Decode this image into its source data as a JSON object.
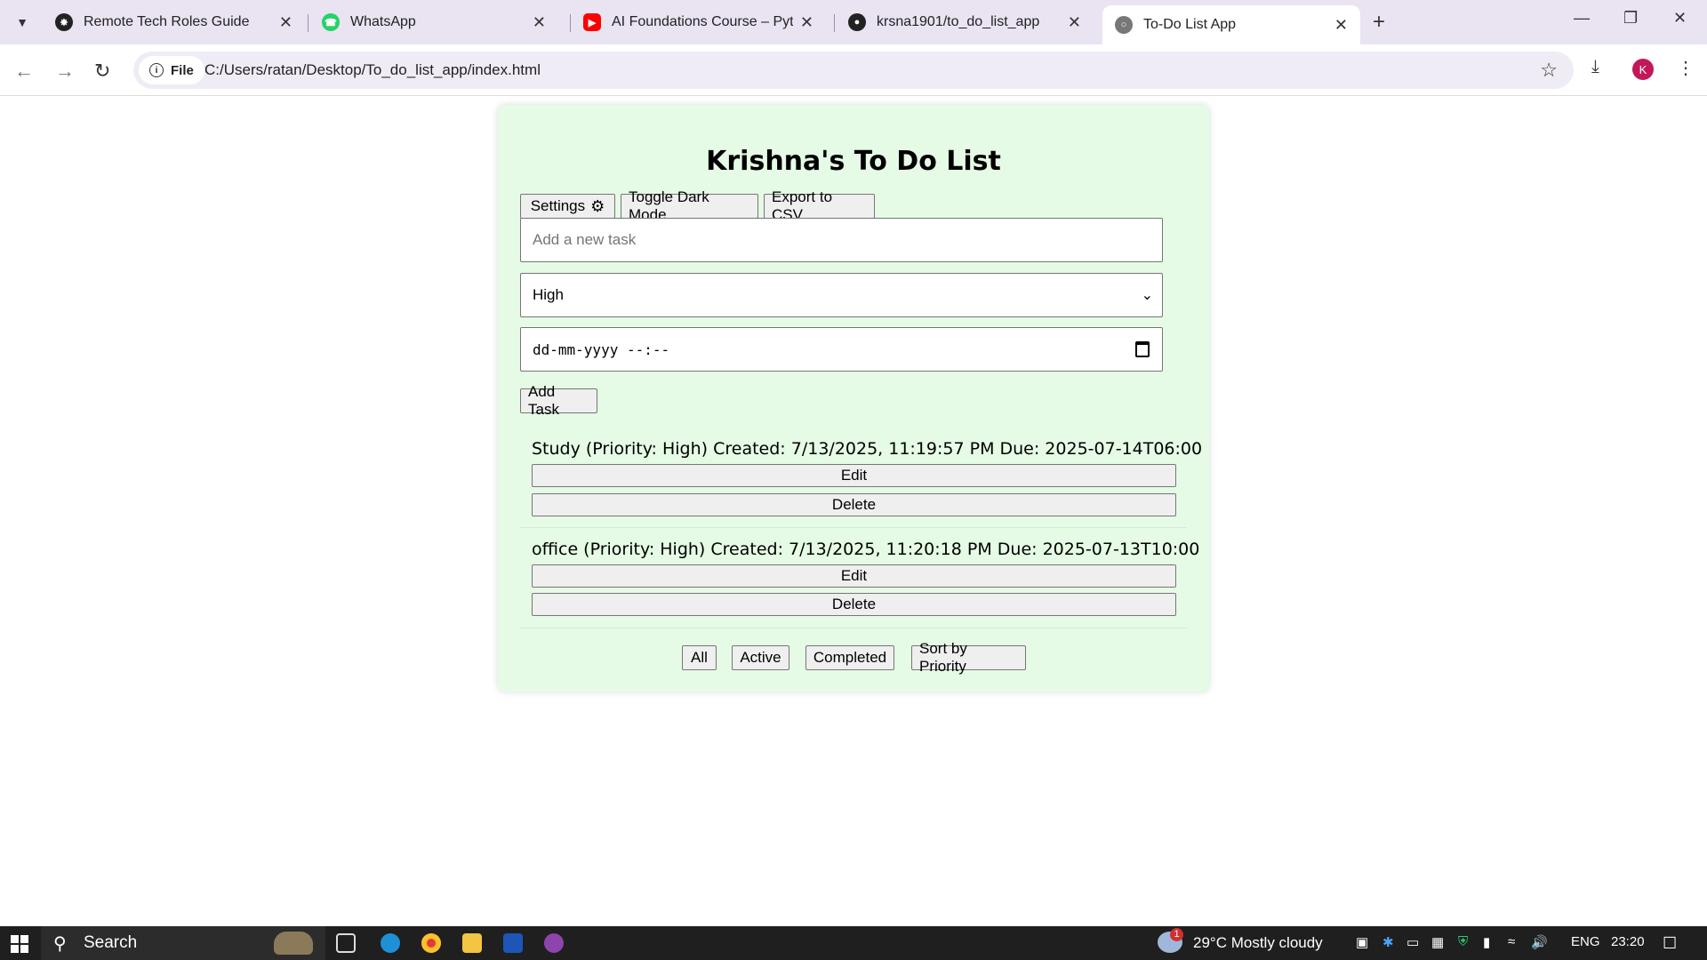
{
  "browser": {
    "tabs": [
      {
        "title": "Remote Tech Roles Guide",
        "icon": "openai-icon"
      },
      {
        "title": "WhatsApp",
        "icon": "whatsapp-icon"
      },
      {
        "title": "AI Foundations Course – Pytho",
        "icon": "youtube-icon"
      },
      {
        "title": "krsna1901/to_do_list_app",
        "icon": "github-icon"
      },
      {
        "title": "To-Do List App",
        "icon": "globe-icon"
      }
    ],
    "chip_label": "File",
    "url": "C:/Users/ratan/Desktop/To_do_list_app/index.html",
    "profile_initial": "K"
  },
  "app": {
    "title": "Krishna's To Do List",
    "settings_label": "Settings",
    "dark_mode_label": "Toggle Dark Mode",
    "export_label": "Export to CSV",
    "task_placeholder": "Add a new task",
    "priority_selected": "High",
    "datetime_placeholder": "dd-mm-yyyy --:--",
    "add_label": "Add Task",
    "tasks": [
      {
        "text": "Study (Priority: High) Created: 7/13/2025, 11:19:57 PM Due: 2025-07-14T06:00",
        "edit": "Edit",
        "delete": "Delete"
      },
      {
        "text": "office (Priority: High) Created: 7/13/2025, 11:20:18 PM Due: 2025-07-13T10:00",
        "edit": "Edit",
        "delete": "Delete"
      }
    ],
    "filters": [
      "All",
      "Active",
      "Completed",
      "Sort by Priority"
    ]
  },
  "taskbar": {
    "search_label": "Search",
    "weather": "29°C  Mostly cloudy",
    "weather_badge": "1",
    "lang": "ENG",
    "time": "23:20"
  },
  "colors": {
    "app_bg": "#e5fbe5",
    "tabbar_bg": "#e9e3f2",
    "taskbar_bg": "#1f1f1f"
  }
}
